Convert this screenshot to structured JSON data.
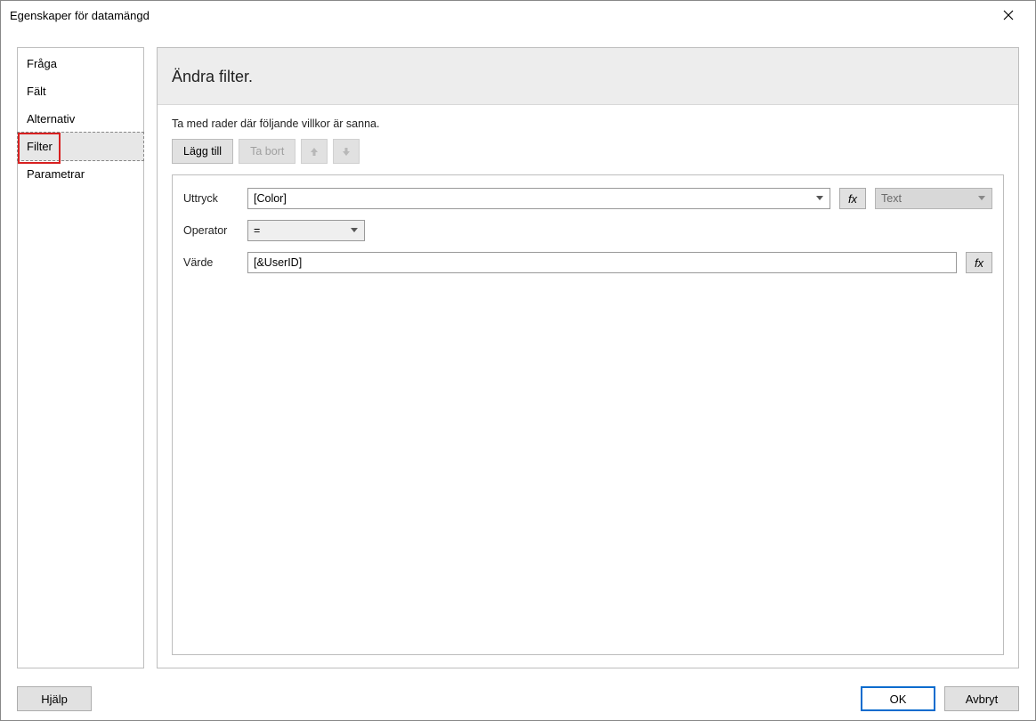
{
  "window": {
    "title": "Egenskaper för datamängd"
  },
  "sidebar": {
    "items": [
      {
        "label": "Fråga"
      },
      {
        "label": "Fält"
      },
      {
        "label": "Alternativ"
      },
      {
        "label": "Filter"
      },
      {
        "label": "Parametrar"
      }
    ]
  },
  "main": {
    "heading": "Ändra filter.",
    "subtitle": "Ta med rader där följande villkor är sanna.",
    "toolbar": {
      "add": "Lägg till",
      "remove": "Ta bort"
    },
    "form": {
      "expression_label": "Uttryck",
      "expression_value": "[Color]",
      "type_value": "Text",
      "operator_label": "Operator",
      "operator_value": "=",
      "value_label": "Värde",
      "value_value": "[&UserID]",
      "fx_label": "fx"
    }
  },
  "footer": {
    "help": "Hjälp",
    "ok": "OK",
    "cancel": "Avbryt"
  }
}
